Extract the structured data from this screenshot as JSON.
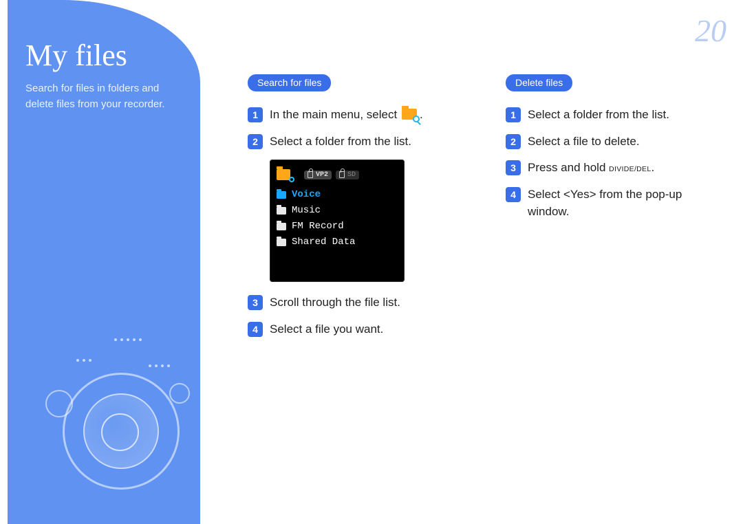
{
  "page_number": "20",
  "sidebar": {
    "title": "My files",
    "subtitle": "Search for files in folders and delete files from your recorder."
  },
  "columns": {
    "search": {
      "heading": "Search for files",
      "steps": {
        "s1_a": "In the main menu, select ",
        "s1_b": ".",
        "s2": "Select a folder from the list.",
        "s3": "Scroll through the file list.",
        "s4": "Select a file you want."
      }
    },
    "delete": {
      "heading": "Delete files",
      "steps": {
        "s1": "Select a folder from the list.",
        "s2": "Select a file to delete.",
        "s3_a": "Press and hold ",
        "s3_key": "DIVIDE/DEL",
        "s3_b": ".",
        "s4": "Select <Yes> from the pop-up window."
      }
    }
  },
  "device": {
    "tab_active": "VP2",
    "tab_sd": "SD",
    "items": [
      "Voice",
      "Music",
      "FM Record",
      "Shared Data"
    ],
    "selected_index": 0
  }
}
